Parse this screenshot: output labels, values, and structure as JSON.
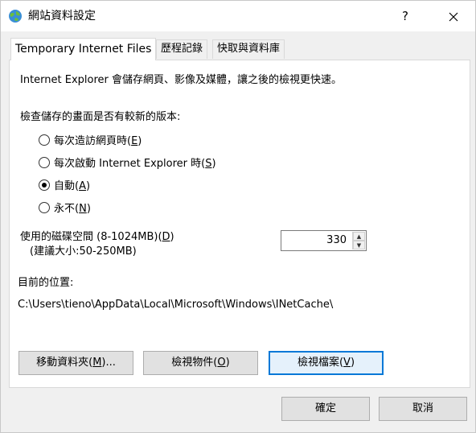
{
  "window": {
    "title": "網站資料設定",
    "help_label": "?",
    "close_label": "✕"
  },
  "tabs": [
    {
      "label": "Temporary Internet Files",
      "active": true
    },
    {
      "label": "歷程記錄",
      "active": false
    },
    {
      "label": "快取與資料庫",
      "active": false
    }
  ],
  "panel": {
    "description": "Internet Explorer 會儲存網頁、影像及媒體，讓之後的檢視更快速。",
    "check_label": "檢查儲存的畫面是否有較新的版本:",
    "radio_options": [
      {
        "text": "每次造訪網頁時(",
        "key": "E",
        "suffix": ")",
        "checked": false
      },
      {
        "text": "每次啟動 Internet Explorer 時(",
        "key": "S",
        "suffix": ")",
        "checked": false
      },
      {
        "text": "自動(",
        "key": "A",
        "suffix": ")",
        "checked": true
      },
      {
        "text": "永不(",
        "key": "N",
        "suffix": ")",
        "checked": false
      }
    ],
    "disk_space_label": "使用的磁碟空間 (8-1024MB)(",
    "disk_space_key": "D",
    "disk_space_suffix": ")",
    "recommended_label": "(建議大小:50-250MB)",
    "disk_space_value": "330",
    "location_label": "目前的位置:",
    "location_path": "C:\\Users\\tieno\\AppData\\Local\\Microsoft\\Windows\\INetCache\\",
    "move_folder": {
      "text": "移動資料夾(",
      "key": "M",
      "suffix": ")..."
    },
    "view_objects": {
      "text": "檢視物件(",
      "key": "O",
      "suffix": ")"
    },
    "view_files": {
      "text": "檢視檔案(",
      "key": "V",
      "suffix": ")"
    }
  },
  "footer": {
    "ok_label": "確定",
    "cancel_label": "取消"
  }
}
